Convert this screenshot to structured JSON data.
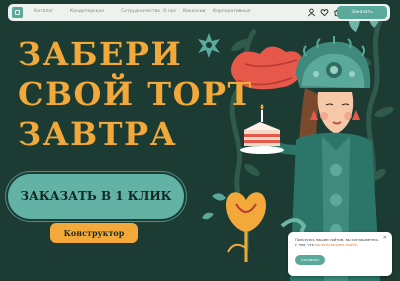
{
  "nav": {
    "items": [
      "Каталог",
      "Кондитерская",
      "Сотрудничество",
      "О нас",
      "Вакансии",
      "Корпоративные"
    ],
    "order_label": "Заказать",
    "icons": [
      "user-icon",
      "heart-icon",
      "cart-icon"
    ]
  },
  "hero": {
    "title_lines": [
      "ЗАБЕРИ",
      "СВОЙ ТОРТ",
      "ЗАВТРА"
    ],
    "cta_main": "ЗАКАЗАТЬ В 1 КЛИК",
    "cta_constructor": "Конструктор"
  },
  "cookie": {
    "text_before": "Пользуясь нашим сайтом, вы соглашаетесь с тем, что ",
    "link_text": "мы используем cookie",
    "text_after": ".",
    "accept_label": "Согласен",
    "close_icon": "close-icon"
  },
  "colors": {
    "background": "#1b3b33",
    "accent_teal": "#5aa99a",
    "title_orange": "#f2a93a",
    "coral": "#e5584a"
  }
}
